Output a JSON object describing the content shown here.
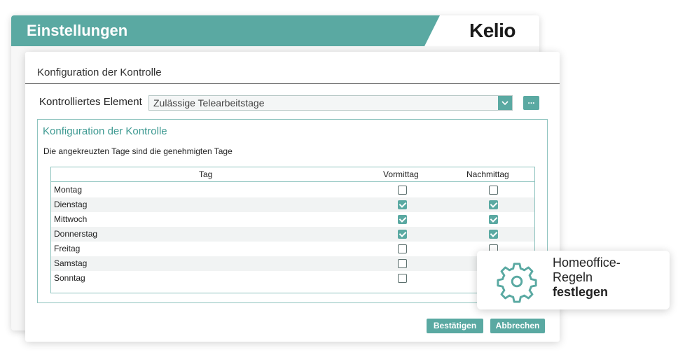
{
  "app": {
    "title": "Einstellungen",
    "logo_text": "Kelio",
    "accent_color": "#5aa9a2"
  },
  "dialog": {
    "title": "Konfiguration der Kontrolle",
    "controlled_element": {
      "label": "Kontrolliertes Element",
      "value": "Zulässige Telearbeitstage",
      "dropdown_icon": "chevron-down-icon",
      "more_button_label": "..."
    },
    "group": {
      "title": "Konfiguration der Kontrolle",
      "description": "Die angekreuzten Tage sind die genehmigten Tage",
      "columns": [
        "Tag",
        "Vormittag",
        "Nachmittag"
      ],
      "rows": [
        {
          "day": "Montag",
          "morning": false,
          "afternoon": false
        },
        {
          "day": "Dienstag",
          "morning": true,
          "afternoon": true
        },
        {
          "day": "Mittwoch",
          "morning": true,
          "afternoon": true
        },
        {
          "day": "Donnerstag",
          "morning": true,
          "afternoon": true
        },
        {
          "day": "Freitag",
          "morning": false,
          "afternoon": false
        },
        {
          "day": "Samstag",
          "morning": false,
          "afternoon": false
        },
        {
          "day": "Sonntag",
          "morning": false,
          "afternoon": false
        }
      ]
    },
    "buttons": {
      "confirm": "Bestätigen",
      "cancel": "Abbrechen"
    }
  },
  "callout": {
    "icon": "gear-icon",
    "line1": "Homeoffice-",
    "line2": "Regeln",
    "line3": "festlegen"
  }
}
